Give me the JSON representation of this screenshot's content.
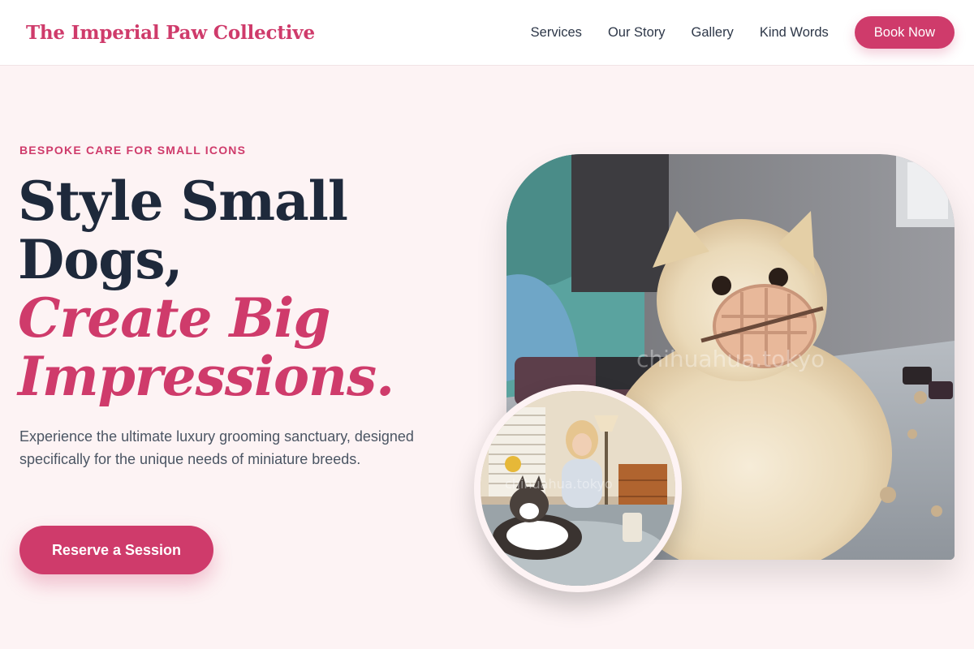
{
  "header": {
    "brand": "The Imperial Paw Collective",
    "nav": [
      "Services",
      "Our Story",
      "Gallery",
      "Kind Words"
    ],
    "book_label": "Book Now"
  },
  "hero": {
    "eyebrow": "BESPOKE CARE FOR SMALL ICONS",
    "headline_line1": "Style Small",
    "headline_line2": "Dogs,",
    "headline_accent1": "Create Big",
    "headline_accent2": "Impressions.",
    "description": "Experience the ultimate luxury grooming sanctuary, designed specifically for the unique needs of miniature breeds.",
    "cta_label": "Reserve a Session",
    "main_image_watermark": "chihuahua.tokyo",
    "inset_image_watermark": "chihuahua.tokyo"
  },
  "colors": {
    "accent": "#cf3b6b",
    "heading": "#1e293b",
    "background": "#fdf3f4"
  }
}
